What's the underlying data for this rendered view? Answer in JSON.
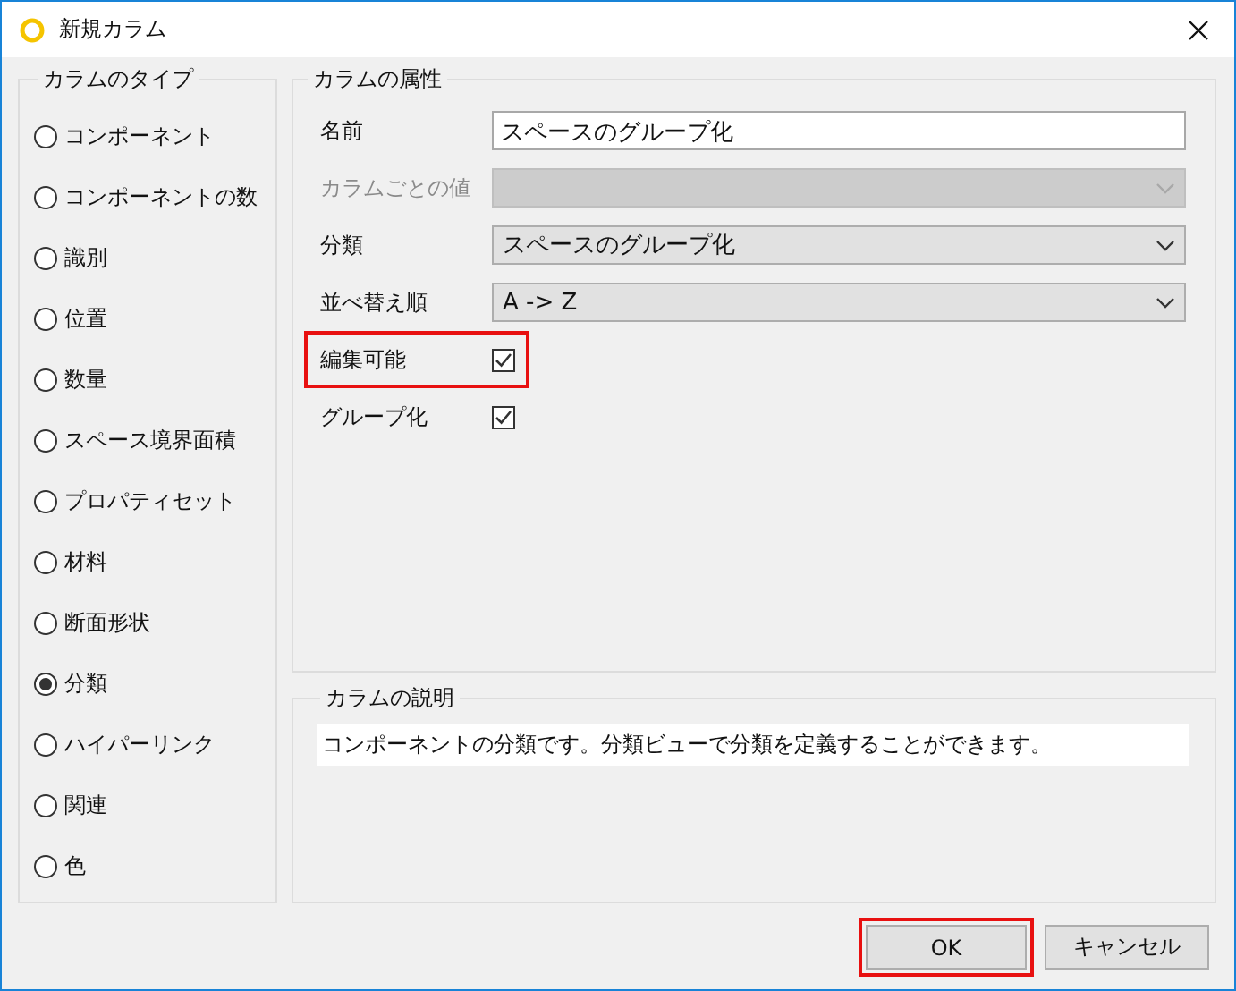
{
  "window": {
    "title": "新規カラム"
  },
  "column_type": {
    "title": "カラムのタイプ",
    "options": [
      {
        "label": "コンポーネント",
        "selected": false
      },
      {
        "label": "コンポーネントの数",
        "selected": false
      },
      {
        "label": "識別",
        "selected": false
      },
      {
        "label": "位置",
        "selected": false
      },
      {
        "label": "数量",
        "selected": false
      },
      {
        "label": "スペース境界面積",
        "selected": false
      },
      {
        "label": "プロパティセット",
        "selected": false
      },
      {
        "label": "材料",
        "selected": false
      },
      {
        "label": "断面形状",
        "selected": false
      },
      {
        "label": "分類",
        "selected": true
      },
      {
        "label": "ハイパーリンク",
        "selected": false
      },
      {
        "label": "関連",
        "selected": false
      },
      {
        "label": "色",
        "selected": false
      }
    ]
  },
  "attributes": {
    "title": "カラムの属性",
    "fields": [
      {
        "kind": "text",
        "label": "名前",
        "value": "スペースのグループ化",
        "disabled": false,
        "highlighted": false
      },
      {
        "kind": "combo",
        "label": "カラムごとの値",
        "disabled": true,
        "highlighted": false
      },
      {
        "kind": "combo",
        "label": "分類",
        "value": "スペースのグループ化",
        "disabled": false,
        "highlighted": false
      },
      {
        "kind": "combo",
        "label": "並べ替え順",
        "value": "A -> Z",
        "disabled": false,
        "highlighted": false
      },
      {
        "kind": "checkbox",
        "label": "編集可能",
        "checked": true,
        "disabled": false,
        "highlighted": true
      },
      {
        "kind": "checkbox",
        "label": "グループ化",
        "checked": true,
        "disabled": false,
        "highlighted": false
      }
    ]
  },
  "description": {
    "title": "カラムの説明",
    "text": "コンポーネントの分類です。分類ビューで分類を定義することができます。"
  },
  "buttons": [
    {
      "label": "OK",
      "highlighted": true
    },
    {
      "label": "キャンセル",
      "highlighted": false
    }
  ]
}
